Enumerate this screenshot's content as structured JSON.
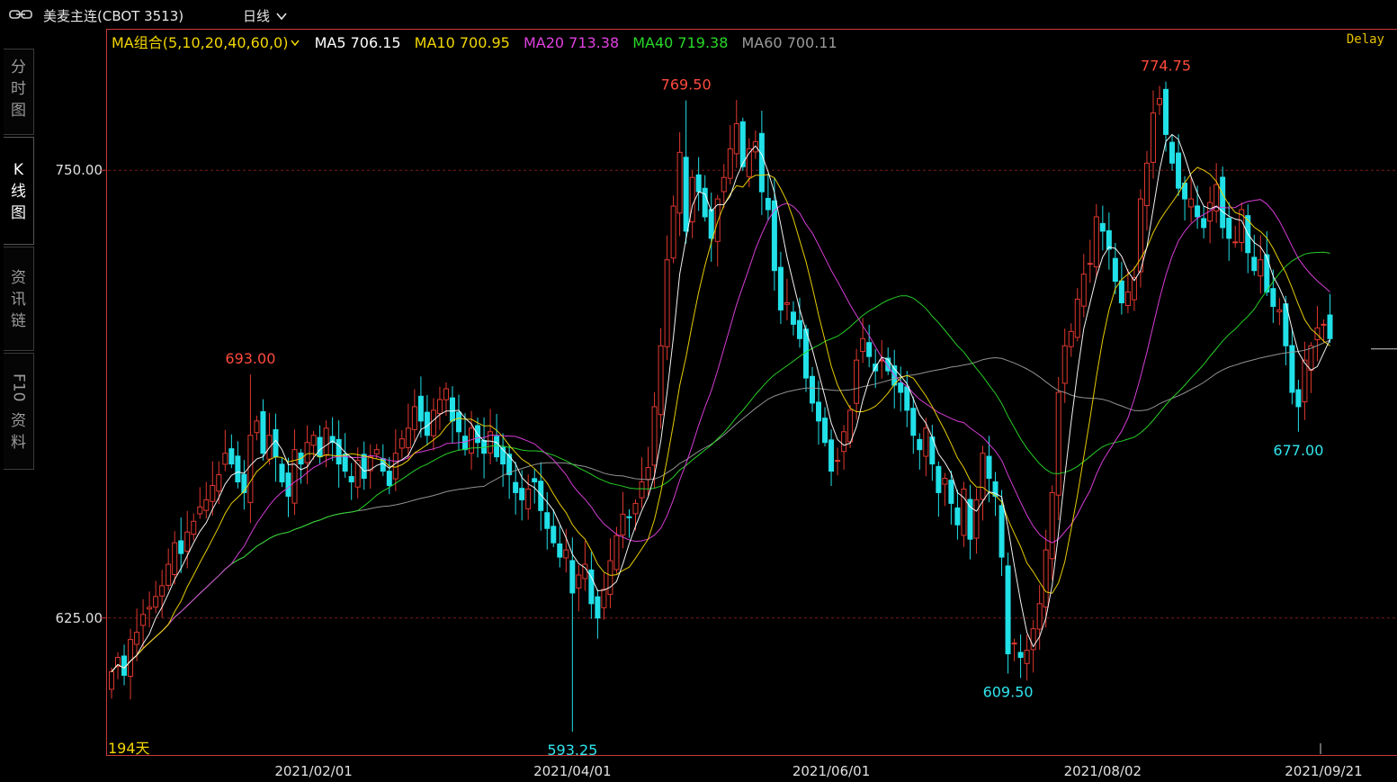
{
  "header": {
    "title": "美麦主连(CBOT 3513)",
    "period": "日线"
  },
  "sidebar": {
    "tabs": [
      {
        "label": "分时图",
        "active": false
      },
      {
        "label": "K线图",
        "active": true
      },
      {
        "label": "资讯链",
        "active": false
      },
      {
        "label": "F10资料",
        "active": false
      }
    ]
  },
  "ma_bar": {
    "group_label": "MA组合(5,10,20,40,60,0)",
    "items": [
      {
        "label": "MA5 706.15",
        "color": "#ffffff"
      },
      {
        "label": "MA10 700.95",
        "color": "#f2d600"
      },
      {
        "label": "MA20 713.38",
        "color": "#e040e0"
      },
      {
        "label": "MA40 719.38",
        "color": "#28d828"
      },
      {
        "label": "MA60 700.11",
        "color": "#9a9a9a"
      }
    ],
    "delay": "Delay"
  },
  "footer": {
    "days_num": "194",
    "days_unit": "天"
  },
  "colors": {
    "up": "#e0382f",
    "down": "#21e0e8",
    "grid": "#7a1a1a",
    "axis": "#c83a3a"
  },
  "chart_data": {
    "type": "candlestick",
    "ylim": [
      587,
      789
    ],
    "yticks": [
      {
        "value": 750,
        "label": "750.00"
      },
      {
        "value": 625,
        "label": "625.00"
      }
    ],
    "xticks": [
      {
        "date": "2021/02/01",
        "index": 32
      },
      {
        "date": "2021/04/01",
        "index": 73
      },
      {
        "date": "2021/06/01",
        "index": 114
      },
      {
        "date": "2021/08/02",
        "index": 157
      },
      {
        "date": "2021/09/21",
        "index": 192
      }
    ],
    "annotations": [
      {
        "index": 22,
        "value": 693.0,
        "label": "693.00",
        "kind": "high"
      },
      {
        "index": 73,
        "value": 593.25,
        "label": "593.25",
        "kind": "low"
      },
      {
        "index": 91,
        "value": 769.5,
        "label": "769.50",
        "kind": "high"
      },
      {
        "index": 142,
        "value": 609.5,
        "label": "609.50",
        "kind": "low"
      },
      {
        "index": 167,
        "value": 774.75,
        "label": "774.75",
        "kind": "high"
      },
      {
        "index": 188,
        "value": 677.0,
        "label": "677.00",
        "kind": "low"
      }
    ],
    "last_price": 700.11,
    "close": [
      610,
      614,
      609,
      619,
      621,
      626,
      628,
      631,
      634,
      640,
      646,
      643,
      649,
      652,
      656,
      658,
      662,
      665,
      671,
      668,
      663,
      660,
      676,
      680,
      671,
      676,
      670,
      663,
      659,
      672,
      668,
      674,
      676,
      670,
      678,
      674,
      668,
      666,
      663,
      669,
      664,
      670,
      672,
      666,
      662,
      671,
      675,
      678,
      684,
      680,
      676,
      683,
      686,
      689,
      680,
      677,
      672,
      678,
      674,
      671,
      677,
      670,
      668,
      665,
      660,
      658,
      661,
      663,
      655,
      650,
      646,
      642,
      644,
      632,
      637,
      640,
      629,
      625,
      633,
      641,
      648,
      654,
      653,
      657,
      663,
      667,
      684,
      701,
      725,
      740,
      755,
      733,
      748,
      744,
      737,
      731,
      742,
      748,
      756,
      763,
      751,
      756,
      758,
      744,
      739,
      722,
      711,
      713,
      707,
      703,
      692,
      685,
      680,
      674,
      666,
      669,
      677,
      683,
      697,
      703,
      698,
      694,
      697,
      694,
      690,
      688,
      683,
      676,
      672,
      678,
      668,
      660,
      664,
      657,
      651,
      661,
      647,
      658,
      671,
      664,
      659,
      642,
      615,
      618,
      614,
      616,
      622,
      629,
      644,
      660,
      688,
      701,
      705,
      714,
      721,
      724,
      737,
      733,
      728,
      719,
      713,
      716,
      720,
      742,
      752,
      766,
      770,
      760,
      752,
      745,
      742,
      742,
      737,
      734,
      741,
      746,
      734,
      731,
      730,
      739,
      727,
      722,
      725,
      716,
      712,
      711,
      701,
      688,
      684,
      697,
      701,
      706,
      707,
      703
    ]
  }
}
